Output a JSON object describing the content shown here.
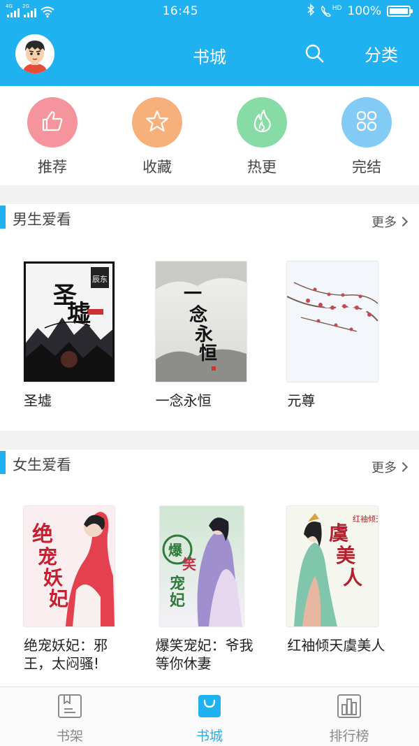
{
  "status_bar": {
    "time": "16:45",
    "battery": "100%",
    "network_tags": [
      "4G",
      "2G"
    ],
    "hd_label": "HD"
  },
  "header": {
    "title": "书城",
    "category_label": "分类",
    "search_icon": "search-icon",
    "background_color": "#1fb1f0"
  },
  "quick_nav": [
    {
      "label": "推荐",
      "icon": "thumbs-up-icon",
      "color": "#f5949d"
    },
    {
      "label": "收藏",
      "icon": "star-icon",
      "color": "#f8b07b"
    },
    {
      "label": "热更",
      "icon": "flame-icon",
      "color": "#87dca6"
    },
    {
      "label": "完结",
      "icon": "grid-icon",
      "color": "#82cbf4"
    }
  ],
  "sections": [
    {
      "title": "男生爱看",
      "more_label": "更多",
      "books": [
        {
          "title": "圣墟",
          "cover_text": "圣墟"
        },
        {
          "title": "一念永恒",
          "cover_text": "一念永恒"
        },
        {
          "title": "元尊",
          "cover_text": ""
        }
      ]
    },
    {
      "title": "女生爱看",
      "more_label": "更多",
      "books": [
        {
          "title": "绝宠妖妃：邪王，太闷骚!",
          "cover_text": "绝宠妖妃"
        },
        {
          "title": "爆笑宠妃：爷我等你休妻",
          "cover_text": "爆笑宠妃"
        },
        {
          "title": "红袖倾天虞美人",
          "cover_text": "虞美人"
        }
      ]
    }
  ],
  "tab_bar": [
    {
      "label": "书架",
      "icon": "bookshelf-icon",
      "active": false
    },
    {
      "label": "书城",
      "icon": "shopping-bag-icon",
      "active": true
    },
    {
      "label": "排行榜",
      "icon": "bar-chart-icon",
      "active": false
    }
  ],
  "colors": {
    "accent": "#1fb1f0",
    "section_gap": "#f2f2f2"
  }
}
